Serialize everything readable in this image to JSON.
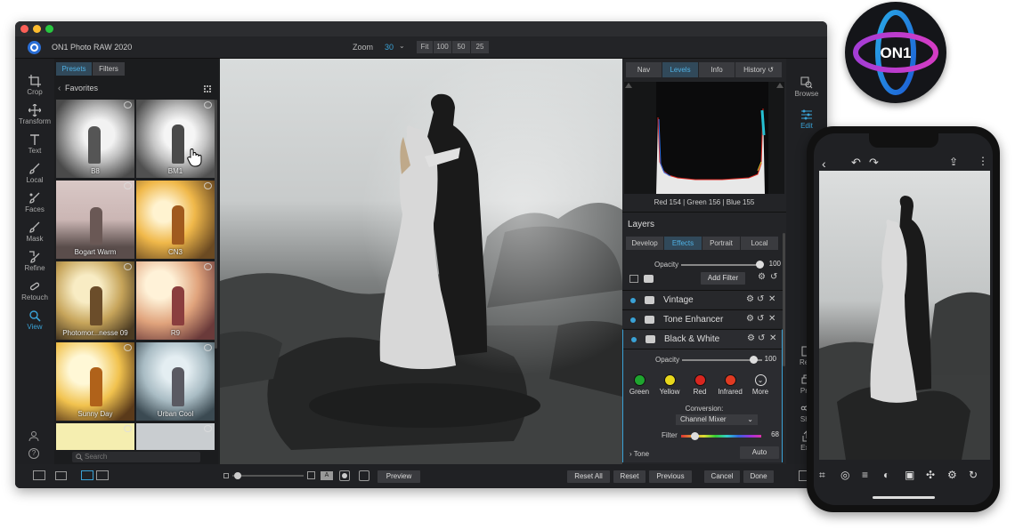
{
  "app": {
    "title": "ON1 Photo RAW 2020"
  },
  "zoom": {
    "label": "Zoom",
    "value": "30",
    "buttons": [
      "Fit",
      "100",
      "50",
      "25"
    ]
  },
  "left_tools": [
    "Crop",
    "Transform",
    "Text",
    "Local",
    "Faces",
    "Mask",
    "Refine",
    "Retouch",
    "View"
  ],
  "presets": {
    "tabs": [
      "Presets",
      "Filters"
    ],
    "header": "Favorites",
    "items": [
      "B8",
      "BM1",
      "Bogart Warm",
      "CN3",
      "Photomor...nesse 09",
      "R9",
      "Sunny Day",
      "Urban Cool"
    ],
    "search_placeholder": "Search"
  },
  "right_panel": {
    "tabs": [
      "Nav",
      "Levels",
      "Info",
      "History"
    ],
    "histogram_readout": "Red 154 | Green 156 | Blue 155",
    "layers_title": "Layers",
    "layer_tabs": [
      "Develop",
      "Effects",
      "Portrait",
      "Local"
    ],
    "opacity_label": "Opacity",
    "opacity_value": "100",
    "add_filter": "Add Filter",
    "filters": [
      "Vintage",
      "Tone Enhancer",
      "Black & White"
    ],
    "bw_opacity_label": "Opacity",
    "bw_opacity_value": "100",
    "colors": [
      {
        "name": "Green",
        "color": "#1fa52f"
      },
      {
        "name": "Yellow",
        "color": "#e8d81c"
      },
      {
        "name": "Red",
        "color": "#d8261f"
      },
      {
        "name": "Infrared",
        "color": "#e03a22"
      },
      {
        "name": "More",
        "color": "none"
      }
    ],
    "conversion_label": "Conversion:",
    "conversion_value": "Channel Mixer",
    "filter_label": "Filter",
    "filter_value": "68",
    "tone_label": "Tone",
    "auto_label": "Auto"
  },
  "right_tools": [
    "Browse",
    "Edit",
    "Resi",
    "Prin",
    "Sha",
    "Exp"
  ],
  "bottom": {
    "preview": "Preview",
    "buttons": [
      "Reset All",
      "Reset",
      "Previous",
      "Cancel",
      "Done"
    ]
  },
  "logo_text": "ON1",
  "colors": {
    "accent": "#3aa2d6",
    "window_bg": "#1d1e20",
    "panel_bg": "#232427"
  }
}
